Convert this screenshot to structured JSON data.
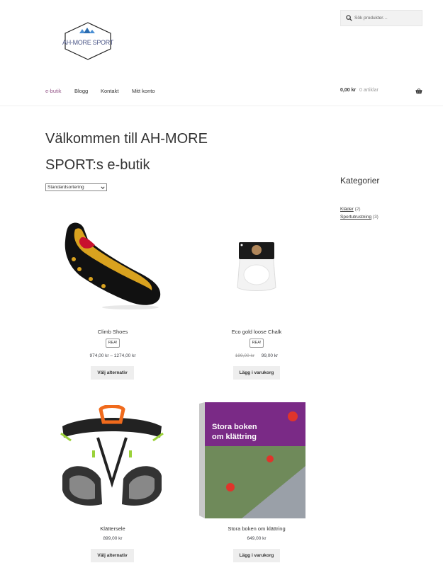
{
  "header": {
    "logo_text": "AH-MORE SPORT",
    "search": {
      "placeholder": "Sök produkter…"
    },
    "nav": [
      {
        "label": "e-butik"
      },
      {
        "label": "Blogg"
      },
      {
        "label": "Kontakt"
      },
      {
        "label": "Mitt konto"
      }
    ],
    "cart": {
      "amount": "0,00 kr",
      "count": "0 artiklar"
    }
  },
  "main": {
    "title": "Välkommen till AH-MORE SPORT:s e-butik",
    "sort": {
      "selected": "Standardsortering"
    },
    "products": [
      {
        "name": "Climb Shoes",
        "badge": "REA!",
        "price": "974,00 kr – 1274,00 kr",
        "button": "Välj alternativ"
      },
      {
        "name": "Eco gold loose Chalk",
        "badge": "REA!",
        "old_price": "199,00 kr",
        "price": "99,00 kr",
        "button": "Lägg i varukorg"
      },
      {
        "name": "Klättersele",
        "price": "899,00 kr",
        "button": "Välj alternativ"
      },
      {
        "name": "Stora boken om klättring",
        "price": "649,00 kr",
        "button": "Lägg i varukorg",
        "cover_title": "Stora boken om klättring"
      }
    ]
  },
  "sidebar": {
    "title": "Kategorier",
    "categories": [
      {
        "name": "Kläder",
        "count": "(2)"
      },
      {
        "name": "Sportutrustning",
        "count": "(3)"
      }
    ]
  },
  "colors": {
    "accent": "#96588a",
    "button_bg": "#eeeeee",
    "text": "#43454b"
  },
  "icons": [
    "search-icon",
    "basket-icon",
    "chevron-down-icon"
  ]
}
